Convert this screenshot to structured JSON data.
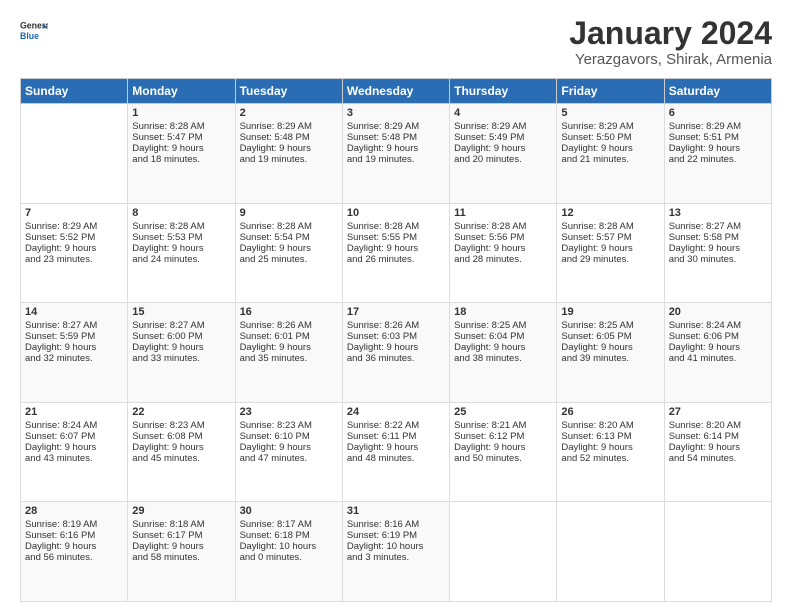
{
  "logo": {
    "general": "General",
    "blue": "Blue"
  },
  "header": {
    "title": "January 2024",
    "subtitle": "Yerazgavors, Shirak, Armenia"
  },
  "days_of_week": [
    "Sunday",
    "Monday",
    "Tuesday",
    "Wednesday",
    "Thursday",
    "Friday",
    "Saturday"
  ],
  "weeks": [
    [
      {
        "day": "",
        "lines": []
      },
      {
        "day": "1",
        "lines": [
          "Sunrise: 8:28 AM",
          "Sunset: 5:47 PM",
          "Daylight: 9 hours",
          "and 18 minutes."
        ]
      },
      {
        "day": "2",
        "lines": [
          "Sunrise: 8:29 AM",
          "Sunset: 5:48 PM",
          "Daylight: 9 hours",
          "and 19 minutes."
        ]
      },
      {
        "day": "3",
        "lines": [
          "Sunrise: 8:29 AM",
          "Sunset: 5:48 PM",
          "Daylight: 9 hours",
          "and 19 minutes."
        ]
      },
      {
        "day": "4",
        "lines": [
          "Sunrise: 8:29 AM",
          "Sunset: 5:49 PM",
          "Daylight: 9 hours",
          "and 20 minutes."
        ]
      },
      {
        "day": "5",
        "lines": [
          "Sunrise: 8:29 AM",
          "Sunset: 5:50 PM",
          "Daylight: 9 hours",
          "and 21 minutes."
        ]
      },
      {
        "day": "6",
        "lines": [
          "Sunrise: 8:29 AM",
          "Sunset: 5:51 PM",
          "Daylight: 9 hours",
          "and 22 minutes."
        ]
      }
    ],
    [
      {
        "day": "7",
        "lines": [
          "Sunrise: 8:29 AM",
          "Sunset: 5:52 PM",
          "Daylight: 9 hours",
          "and 23 minutes."
        ]
      },
      {
        "day": "8",
        "lines": [
          "Sunrise: 8:28 AM",
          "Sunset: 5:53 PM",
          "Daylight: 9 hours",
          "and 24 minutes."
        ]
      },
      {
        "day": "9",
        "lines": [
          "Sunrise: 8:28 AM",
          "Sunset: 5:54 PM",
          "Daylight: 9 hours",
          "and 25 minutes."
        ]
      },
      {
        "day": "10",
        "lines": [
          "Sunrise: 8:28 AM",
          "Sunset: 5:55 PM",
          "Daylight: 9 hours",
          "and 26 minutes."
        ]
      },
      {
        "day": "11",
        "lines": [
          "Sunrise: 8:28 AM",
          "Sunset: 5:56 PM",
          "Daylight: 9 hours",
          "and 28 minutes."
        ]
      },
      {
        "day": "12",
        "lines": [
          "Sunrise: 8:28 AM",
          "Sunset: 5:57 PM",
          "Daylight: 9 hours",
          "and 29 minutes."
        ]
      },
      {
        "day": "13",
        "lines": [
          "Sunrise: 8:27 AM",
          "Sunset: 5:58 PM",
          "Daylight: 9 hours",
          "and 30 minutes."
        ]
      }
    ],
    [
      {
        "day": "14",
        "lines": [
          "Sunrise: 8:27 AM",
          "Sunset: 5:59 PM",
          "Daylight: 9 hours",
          "and 32 minutes."
        ]
      },
      {
        "day": "15",
        "lines": [
          "Sunrise: 8:27 AM",
          "Sunset: 6:00 PM",
          "Daylight: 9 hours",
          "and 33 minutes."
        ]
      },
      {
        "day": "16",
        "lines": [
          "Sunrise: 8:26 AM",
          "Sunset: 6:01 PM",
          "Daylight: 9 hours",
          "and 35 minutes."
        ]
      },
      {
        "day": "17",
        "lines": [
          "Sunrise: 8:26 AM",
          "Sunset: 6:03 PM",
          "Daylight: 9 hours",
          "and 36 minutes."
        ]
      },
      {
        "day": "18",
        "lines": [
          "Sunrise: 8:25 AM",
          "Sunset: 6:04 PM",
          "Daylight: 9 hours",
          "and 38 minutes."
        ]
      },
      {
        "day": "19",
        "lines": [
          "Sunrise: 8:25 AM",
          "Sunset: 6:05 PM",
          "Daylight: 9 hours",
          "and 39 minutes."
        ]
      },
      {
        "day": "20",
        "lines": [
          "Sunrise: 8:24 AM",
          "Sunset: 6:06 PM",
          "Daylight: 9 hours",
          "and 41 minutes."
        ]
      }
    ],
    [
      {
        "day": "21",
        "lines": [
          "Sunrise: 8:24 AM",
          "Sunset: 6:07 PM",
          "Daylight: 9 hours",
          "and 43 minutes."
        ]
      },
      {
        "day": "22",
        "lines": [
          "Sunrise: 8:23 AM",
          "Sunset: 6:08 PM",
          "Daylight: 9 hours",
          "and 45 minutes."
        ]
      },
      {
        "day": "23",
        "lines": [
          "Sunrise: 8:23 AM",
          "Sunset: 6:10 PM",
          "Daylight: 9 hours",
          "and 47 minutes."
        ]
      },
      {
        "day": "24",
        "lines": [
          "Sunrise: 8:22 AM",
          "Sunset: 6:11 PM",
          "Daylight: 9 hours",
          "and 48 minutes."
        ]
      },
      {
        "day": "25",
        "lines": [
          "Sunrise: 8:21 AM",
          "Sunset: 6:12 PM",
          "Daylight: 9 hours",
          "and 50 minutes."
        ]
      },
      {
        "day": "26",
        "lines": [
          "Sunrise: 8:20 AM",
          "Sunset: 6:13 PM",
          "Daylight: 9 hours",
          "and 52 minutes."
        ]
      },
      {
        "day": "27",
        "lines": [
          "Sunrise: 8:20 AM",
          "Sunset: 6:14 PM",
          "Daylight: 9 hours",
          "and 54 minutes."
        ]
      }
    ],
    [
      {
        "day": "28",
        "lines": [
          "Sunrise: 8:19 AM",
          "Sunset: 6:16 PM",
          "Daylight: 9 hours",
          "and 56 minutes."
        ]
      },
      {
        "day": "29",
        "lines": [
          "Sunrise: 8:18 AM",
          "Sunset: 6:17 PM",
          "Daylight: 9 hours",
          "and 58 minutes."
        ]
      },
      {
        "day": "30",
        "lines": [
          "Sunrise: 8:17 AM",
          "Sunset: 6:18 PM",
          "Daylight: 10 hours",
          "and 0 minutes."
        ]
      },
      {
        "day": "31",
        "lines": [
          "Sunrise: 8:16 AM",
          "Sunset: 6:19 PM",
          "Daylight: 10 hours",
          "and 3 minutes."
        ]
      },
      {
        "day": "",
        "lines": []
      },
      {
        "day": "",
        "lines": []
      },
      {
        "day": "",
        "lines": []
      }
    ]
  ]
}
